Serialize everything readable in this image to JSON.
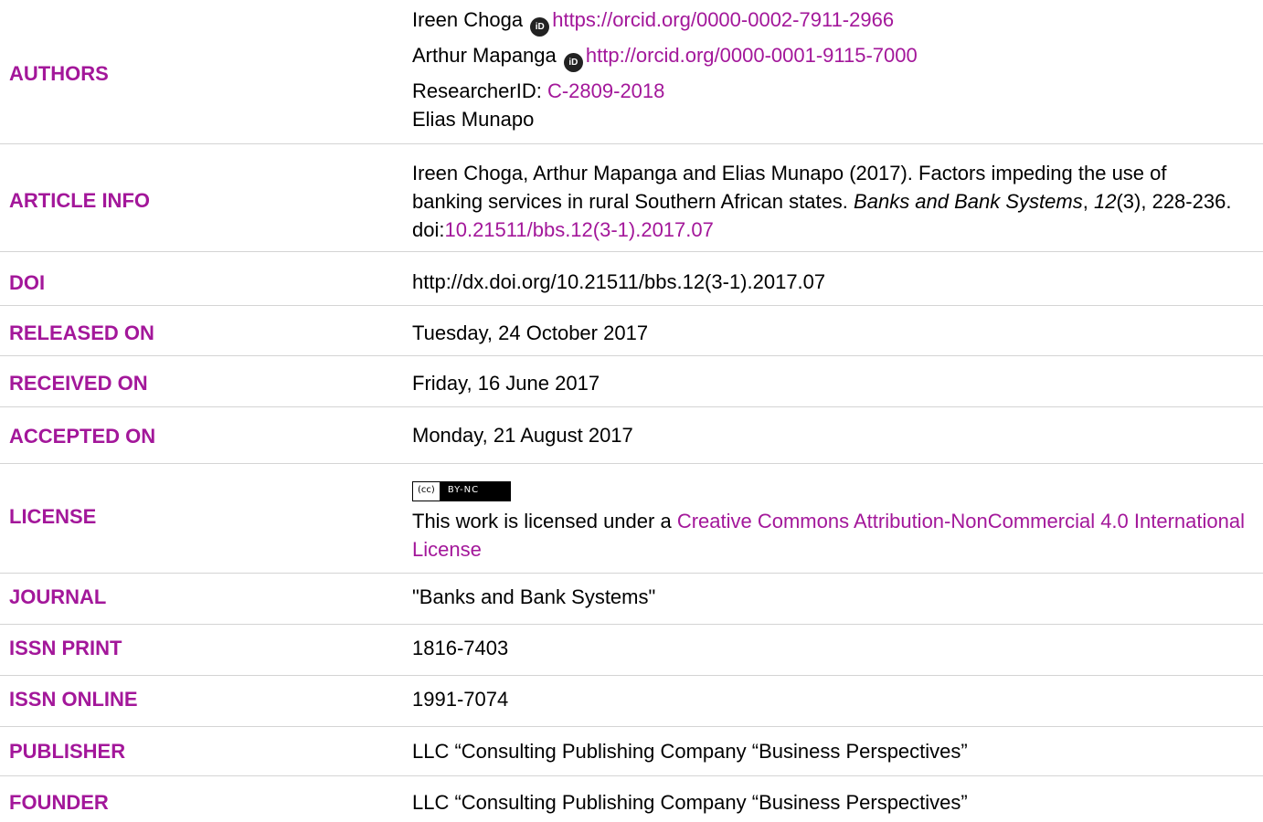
{
  "authors": {
    "label": "AUTHORS",
    "people": [
      {
        "name": "Ireen Choga",
        "orcid_url": "https://orcid.org/0000-0002-7911-2966"
      },
      {
        "name": "Arthur Mapanga",
        "orcid_url": "http://orcid.org/0000-0001-9115-7000"
      }
    ],
    "researcher_id_label": "ResearcherID:",
    "researcher_id": "C-2809-2018",
    "third_author": "Elias Munapo"
  },
  "article_info": {
    "label": "ARTICLE INFO",
    "text_main": "Ireen Choga, Arthur Mapanga and Elias Munapo (2017). Factors impeding the use of banking services in rural Southern African states.",
    "journal_italic": "Banks and Bank Systems",
    "comma": ",",
    "volume_italic": "12",
    "issue_pages": "(3), 228-236. doi:",
    "doi_link": "10.21511/bbs.12(3-1).2017.07"
  },
  "doi": {
    "label": "DOI",
    "value": "http://dx.doi.org/10.21511/bbs.12(3-1).2017.07"
  },
  "released": {
    "label": "RELEASED ON",
    "value": "Tuesday, 24 October 2017"
  },
  "received": {
    "label": "RECEIVED ON",
    "value": "Friday, 16 June 2017"
  },
  "accepted": {
    "label": "ACCEPTED ON",
    "value": "Monday, 21 August 2017"
  },
  "license": {
    "label": "LICENSE",
    "badge_cc": "(cc)",
    "badge_terms": "BY-NC",
    "text_prefix": "This work is licensed under a",
    "link": "Creative Commons Attribution-NonCommercial 4.0 International License"
  },
  "journal": {
    "label": "JOURNAL",
    "value": "\"Banks and Bank Systems\""
  },
  "issn_print": {
    "label": "ISSN PRINT",
    "value": "1816-7403"
  },
  "issn_online": {
    "label": "ISSN ONLINE",
    "value": "1991-7074"
  },
  "publisher": {
    "label": "PUBLISHER",
    "value": "LLC “Consulting Publishing Company “Business Perspectives”"
  },
  "founder": {
    "label": "FOUNDER",
    "value": "LLC “Consulting Publishing Company “Business Perspectives”"
  },
  "colors": {
    "accent": "#a3179a",
    "divider": "#d4d4d4"
  }
}
